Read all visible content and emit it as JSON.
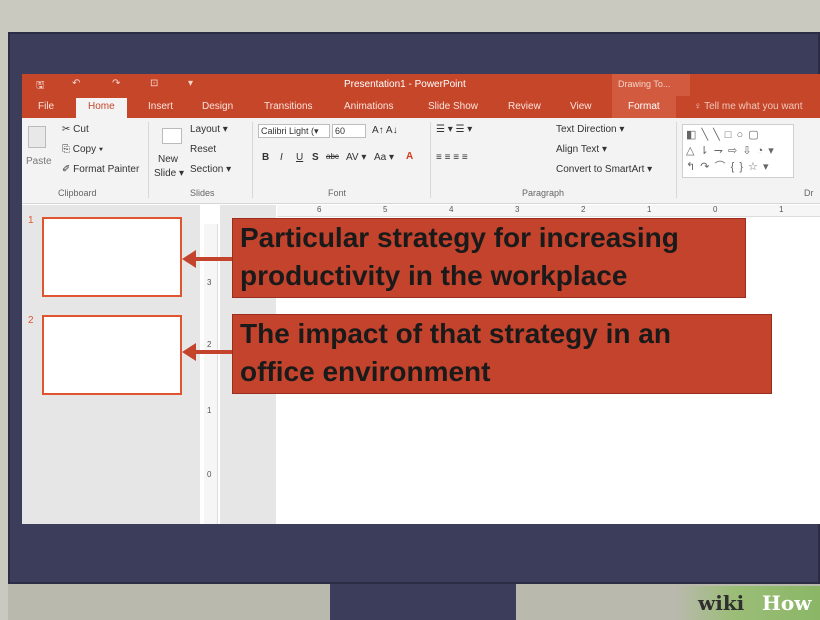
{
  "titlebar": {
    "qa_save": "🖫",
    "qa_undo": "↶",
    "qa_redo": "↷",
    "qa_present": "⊡",
    "qa_more": "▾",
    "title": "Presentation1 - PowerPoint",
    "contextual": "Drawing To..."
  },
  "tabs": {
    "file": "File",
    "home": "Home",
    "insert": "Insert",
    "design": "Design",
    "transitions": "Transitions",
    "animations": "Animations",
    "slideshow": "Slide Show",
    "review": "Review",
    "view": "View",
    "format": "Format",
    "tell": "♀ Tell me what you want"
  },
  "ribbon": {
    "paste": "Paste",
    "cut": "✂ Cut",
    "copy": "⎘ Copy ▾",
    "format_painter": "✐ Format Painter",
    "clipboard": "Clipboard",
    "new": "New",
    "slide": "Slide ▾",
    "layout": "Layout ▾",
    "reset": "Reset",
    "section": "Section ▾",
    "slides": "Slides",
    "font_name": "Calibri Light (▾",
    "font_size": "60",
    "grow": "A↑ A↓",
    "bold": "B",
    "italic": "I",
    "underline": "U",
    "shadow": "S",
    "strike": "abc",
    "spacing": "AV ▾",
    "case": "Aa ▾",
    "font_color": "A",
    "font": "Font",
    "bullets": "☰ ▾ ☰ ▾",
    "align": "≡ ≡ ≡ ≡",
    "paragraph": "Paragraph",
    "text_direction": "Text Direction ▾",
    "align_text": "Align Text ▾",
    "smartart": "Convert to SmartArt ▾",
    "shapes_row1": "◧ ╲ ╲ □ ○ ▢",
    "shapes_row2": "△ ⇂ ⇁ ⇨ ⇩ ◔ ▾",
    "shapes_row3": "↰ ↷ ⌒ { } ☆ ▾",
    "draw": "Dr"
  },
  "thumbs": {
    "num1": "1",
    "num2": "2"
  },
  "hruler": [
    "6",
    "5",
    "4",
    "3",
    "2",
    "1",
    "0",
    "1"
  ],
  "vruler": [
    "3",
    "2",
    "1",
    "0"
  ],
  "callouts": {
    "first": [
      "Particular strategy for increasing",
      "productivity in the workplace"
    ],
    "second": [
      "The impact of that strategy in an",
      "office environment"
    ]
  },
  "colors": {
    "accent": "#c6462a",
    "callout": "#c4432c",
    "thumb_border": "#e0552f"
  },
  "watermark": {
    "wiki": "wiki",
    "how": "How"
  }
}
